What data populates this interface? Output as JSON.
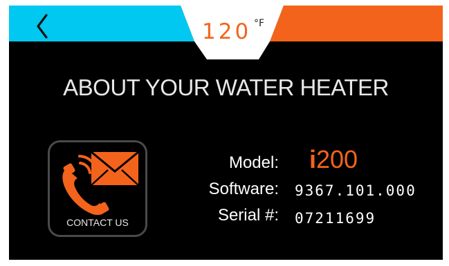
{
  "colors": {
    "accent_cyan": "#00c8f0",
    "accent_orange": "#f3631c",
    "background": "#000000"
  },
  "header": {
    "back_icon": "chevron-left-icon",
    "temperature": {
      "value": "120",
      "unit": "°F"
    }
  },
  "page": {
    "title": "ABOUT YOUR WATER HEATER"
  },
  "contact": {
    "label": "CONTACT US",
    "icon": "phone-envelope-icon"
  },
  "info": {
    "model": {
      "label": "Model:",
      "value_prefix": "i",
      "value_rest": "200"
    },
    "software": {
      "label": "Software:",
      "value": "9367.101.000"
    },
    "serial": {
      "label": "Serial #:",
      "value": "07211699"
    }
  }
}
